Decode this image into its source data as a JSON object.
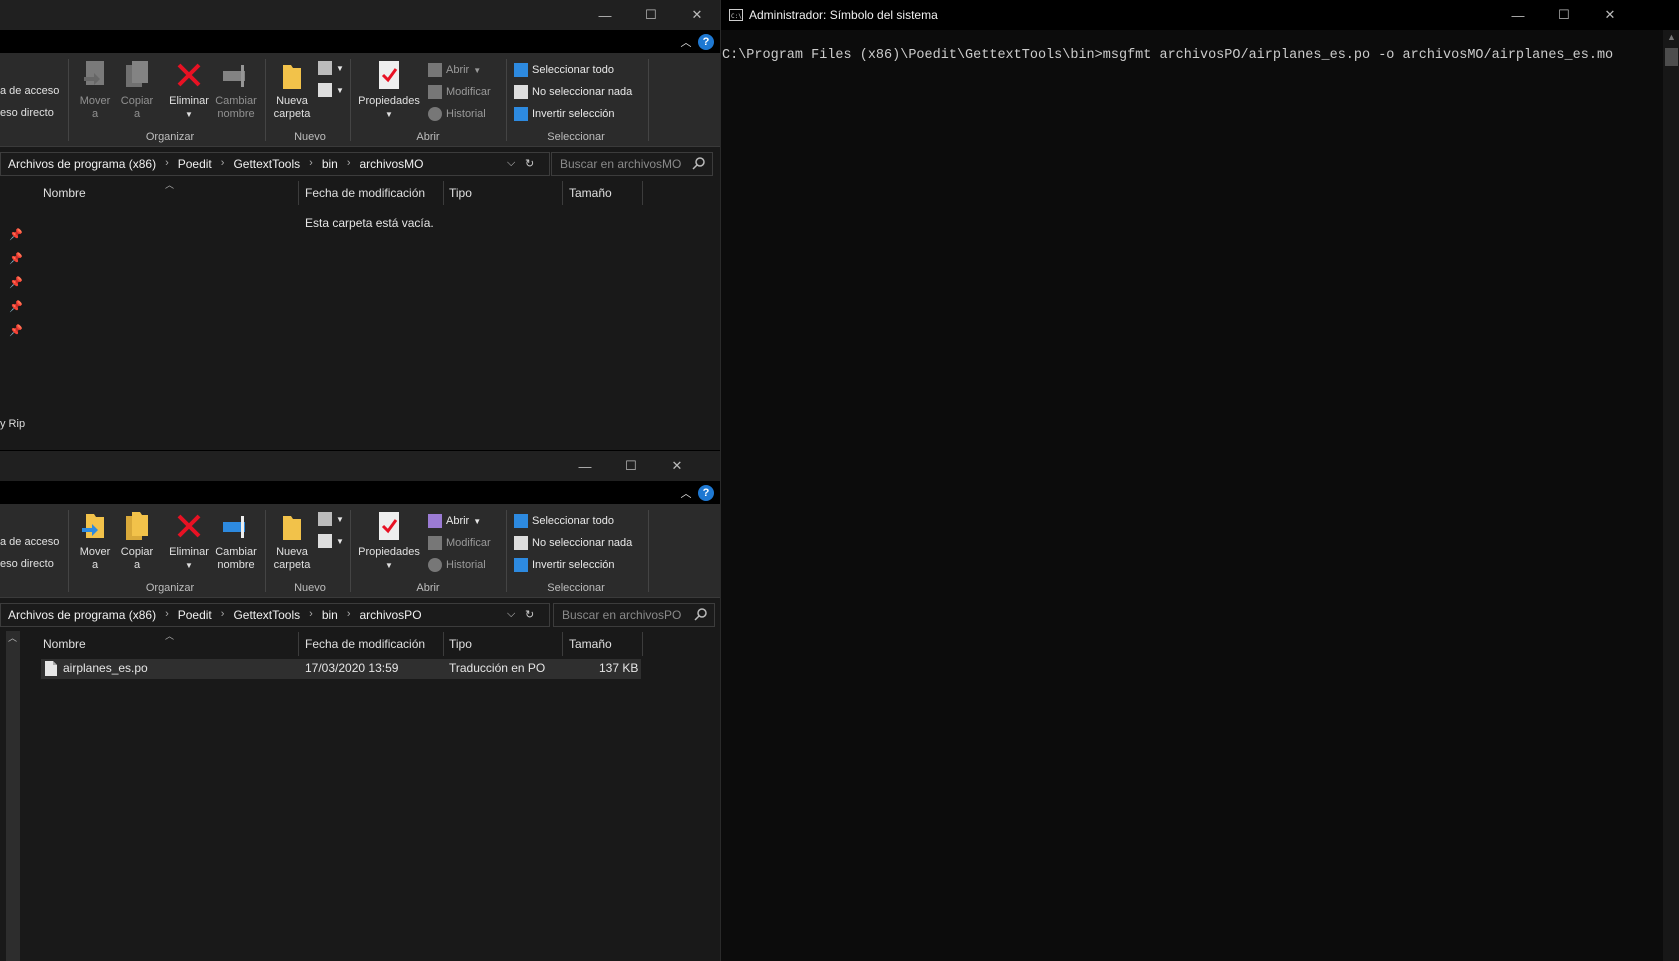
{
  "explorer_top": {
    "ribbon": {
      "left_cut": {
        "line1": "a de acceso",
        "line2": "eso directo"
      },
      "organizar": {
        "group_label": "Organizar",
        "mover_label": "Mover",
        "mover_sub": "a",
        "copiar_label": "Copiar",
        "copiar_sub": "a",
        "eliminar_label": "Eliminar",
        "cambiar_line1": "Cambiar",
        "cambiar_line2": "nombre"
      },
      "nuevo": {
        "group_label": "Nuevo",
        "nueva_line1": "Nueva",
        "nueva_line2": "carpeta"
      },
      "abrir": {
        "group_label": "Abrir",
        "propiedades": "Propiedades",
        "abrir": "Abrir",
        "modificar": "Modificar",
        "historial": "Historial"
      },
      "seleccionar": {
        "group_label": "Seleccionar",
        "todo": "Seleccionar todo",
        "nada": "No seleccionar nada",
        "invertir": "Invertir selección"
      }
    },
    "breadcrumb": [
      "Archivos de programa (x86)",
      "Poedit",
      "GettextTools",
      "bin",
      "archivosMO"
    ],
    "search_placeholder": "Buscar en archivosMO",
    "columns": {
      "name": "Nombre",
      "date": "Fecha de modificación",
      "type": "Tipo",
      "size": "Tamaño"
    },
    "empty_message": "Esta carpeta está vacía.",
    "nav_cut_label": "y Rip"
  },
  "explorer_bottom": {
    "ribbon": {
      "left_cut": {
        "line1": "a de acceso",
        "line2": "eso directo"
      },
      "organizar": {
        "group_label": "Organizar",
        "mover_label": "Mover",
        "mover_sub": "a",
        "copiar_label": "Copiar",
        "copiar_sub": "a",
        "eliminar_label": "Eliminar",
        "cambiar_line1": "Cambiar",
        "cambiar_line2": "nombre"
      },
      "nuevo": {
        "group_label": "Nuevo",
        "nueva_line1": "Nueva",
        "nueva_line2": "carpeta"
      },
      "abrir": {
        "group_label": "Abrir",
        "propiedades": "Propiedades",
        "abrir": "Abrir",
        "modificar": "Modificar",
        "historial": "Historial"
      },
      "seleccionar": {
        "group_label": "Seleccionar",
        "todo": "Seleccionar todo",
        "nada": "No seleccionar nada",
        "invertir": "Invertir selección"
      }
    },
    "breadcrumb": [
      "Archivos de programa (x86)",
      "Poedit",
      "GettextTools",
      "bin",
      "archivosPO"
    ],
    "search_placeholder": "Buscar en archivosPO",
    "columns": {
      "name": "Nombre",
      "date": "Fecha de modificación",
      "type": "Tipo",
      "size": "Tamaño"
    },
    "files": [
      {
        "name": "airplanes_es.po",
        "date": "17/03/2020 13:59",
        "type": "Traducción en PO",
        "size": "137 KB"
      }
    ]
  },
  "cmd": {
    "title": "Administrador: Símbolo del sistema",
    "command_line": "C:\\Program Files (x86)\\Poedit\\GettextTools\\bin>msgfmt archivosPO/airplanes_es.po -o archivosMO/airplanes_es.mo"
  },
  "icons": {
    "minimize": "minimize-icon",
    "maximize": "maximize-icon",
    "close": "close-icon",
    "help": "help-icon",
    "search": "search-icon",
    "refresh": "refresh-icon",
    "pin": "pin-icon"
  },
  "colors": {
    "explorer_bg": "#191919",
    "ribbon_bg": "#2b2b2b",
    "cmd_bg": "#0c0c0c",
    "accent_blue": "#1e78d2",
    "delete_red": "#e81123",
    "folder_yellow": "#f2c24a"
  }
}
